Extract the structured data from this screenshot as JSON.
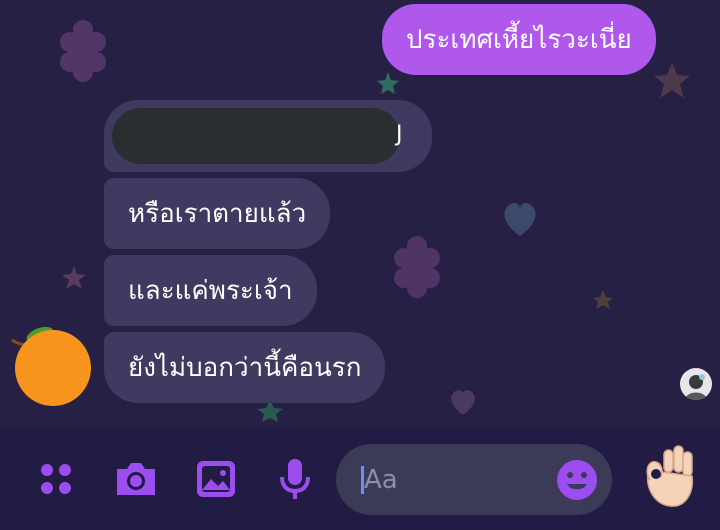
{
  "thread": {
    "outgoing": [
      {
        "text": "ประเทศเหี้ยไรวะเนี่ย"
      }
    ],
    "incoming": [
      {
        "text": "",
        "redacted": true,
        "trailing_glyph": " J"
      },
      {
        "text": "หรือเราตายแล้ว"
      },
      {
        "text": "และแค่พระเจ้า"
      },
      {
        "text": "ยังไม่บอกว่านี้คือนรก"
      }
    ]
  },
  "composer": {
    "placeholder": "Aa",
    "icons": [
      "apps-icon",
      "camera-icon",
      "gallery-icon",
      "microphone-icon",
      "emoji-icon",
      "ok-hand-icon"
    ]
  },
  "theme": {
    "accent": "#9b4df0",
    "outgoing_bubble": "#b057ec",
    "incoming_bubble": "#3f3a5f",
    "background": "#262045",
    "composer_bar": "#221c45"
  }
}
